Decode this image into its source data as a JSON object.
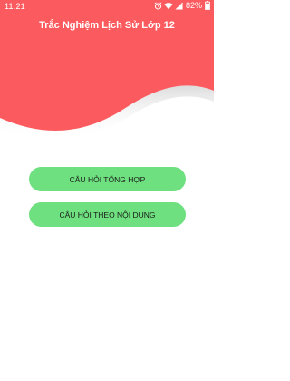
{
  "status_bar": {
    "time": "11:21",
    "battery": "82%"
  },
  "header": {
    "title": "Trắc Nghiệm Lịch Sử Lớp 12",
    "color": "#fb5b5f"
  },
  "buttons": {
    "general": "CÂU HỎI TỔNG HỢP",
    "by_topic": "CÂU HỎI THEO NỘI DUNG",
    "color": "#6ee07f"
  },
  "icons": [
    "alarm-icon",
    "wifi-icon",
    "signal-icon",
    "battery-icon"
  ]
}
